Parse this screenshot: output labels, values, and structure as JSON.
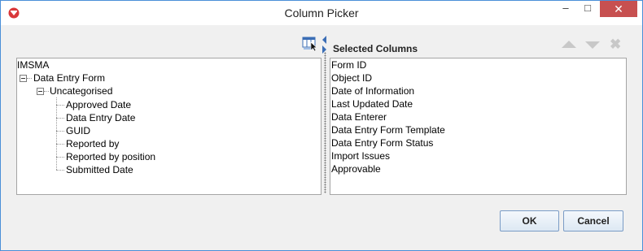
{
  "window": {
    "title": "Column Picker"
  },
  "titlebar_buttons": {
    "minimize": "–",
    "maximize": "□",
    "close": "✕"
  },
  "tree": {
    "root": "IMSMA",
    "form": "Data Entry Form",
    "group": "Uncategorised",
    "fields": [
      "Approved Date",
      "Data Entry Date",
      "GUID",
      "Reported by",
      "Reported by position",
      "Submitted Date"
    ]
  },
  "selected": {
    "header": "Selected Columns",
    "items": [
      "Form ID",
      "Object ID",
      "Date of Information",
      "Last Updated Date",
      "Data Enterer",
      "Data Entry Form Template",
      "Data Entry Form Status",
      "Import Issues",
      "Approvable"
    ]
  },
  "buttons": {
    "ok": "OK",
    "cancel": "Cancel"
  },
  "icons": {
    "move_up": "triangle-up-icon",
    "move_down": "triangle-down-icon",
    "remove": "remove-x-icon",
    "column_picker": "table-columns-icon"
  },
  "colors": {
    "window_border": "#4a8fd8",
    "close_button": "#c75050",
    "disabled_tool": "#c8c8c8"
  }
}
